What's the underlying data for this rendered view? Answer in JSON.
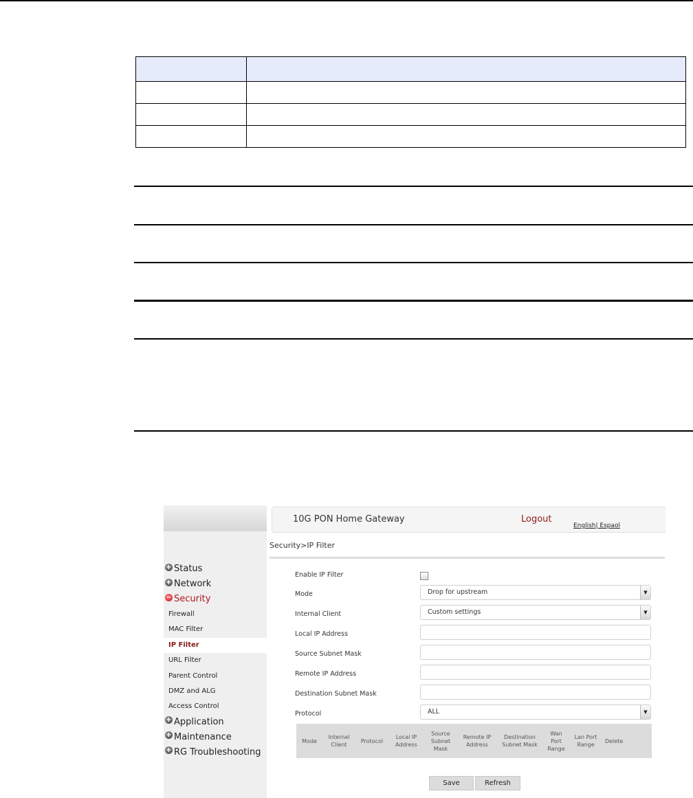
{
  "document": {
    "table": {
      "header": [
        "",
        ""
      ],
      "rows": [
        [
          "",
          ""
        ],
        [
          "",
          ""
        ],
        [
          "",
          ""
        ]
      ]
    },
    "rules_count": 7
  },
  "ui": {
    "header": {
      "brand": "10G PON Home Gateway",
      "logout": "Logout",
      "lang_english": "English",
      "lang_separator": "|",
      "lang_spanish": " Espaol"
    },
    "breadcrumb": "Security>IP Filter",
    "sidebar": {
      "items": [
        {
          "label": "Status",
          "icon": "plus-circle-icon"
        },
        {
          "label": "Network",
          "icon": "plus-circle-icon"
        },
        {
          "label": "Security",
          "icon": "minus-circle-icon",
          "active": true,
          "children": [
            "Firewall",
            "MAC Filter",
            "IP Filter",
            "URL Filter",
            "Parent Control",
            "DMZ and ALG",
            "Access Control"
          ],
          "selected_child": "IP Filter"
        },
        {
          "label": "Application",
          "icon": "plus-circle-icon"
        },
        {
          "label": "Maintenance",
          "icon": "plus-circle-icon"
        },
        {
          "label": "RG Troubleshooting",
          "icon": "plus-circle-icon"
        }
      ]
    },
    "form": {
      "enable_label": "Enable IP Filter",
      "enable_checked": false,
      "mode_label": "Mode",
      "mode_value": "Drop for upstream",
      "internal_client_label": "Internal Client",
      "internal_client_value": "Custom settings",
      "local_ip_label": "Local IP Address",
      "local_ip_value": "",
      "source_mask_label": "Source Subnet Mask",
      "source_mask_value": "",
      "remote_ip_label": "Remote IP Address",
      "remote_ip_value": "",
      "dest_mask_label": "Destination Subnet Mask",
      "dest_mask_value": "",
      "protocol_label": "Protocol",
      "protocol_value": "ALL"
    },
    "rules_table": {
      "columns": [
        "Mode",
        "Internal Client",
        "Protocol",
        "Local IP Address",
        "Source Subnet Mask",
        "Remote IP Address",
        "Destination Subnet Mask",
        "Wan Port Range",
        "Lan Port Range",
        "Delete"
      ]
    },
    "buttons": {
      "save": "Save",
      "refresh": "Refresh"
    },
    "colors": {
      "accent": "#8b1a1a",
      "table_header_bg": "#e6ebfb"
    }
  }
}
